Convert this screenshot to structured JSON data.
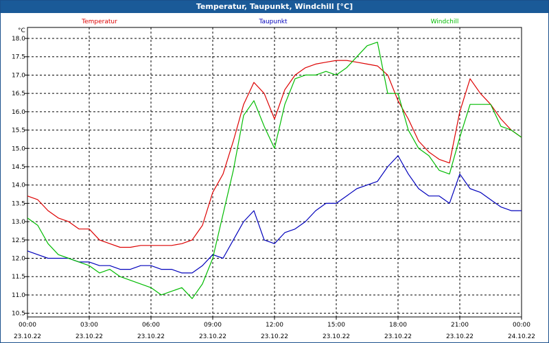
{
  "title": "Temperatur, Taupunkt, Windchill [°C]",
  "unit": "°C",
  "colors": {
    "titlebar": "#1a5a98",
    "temperatur": "#dd0000",
    "taupunkt": "#0000bb",
    "windchill": "#00bb00",
    "grid": "#000000"
  },
  "chart_data": {
    "type": "line",
    "title": "Temperatur, Taupunkt, Windchill [°C]",
    "ylabel": "°C",
    "xlabel": "",
    "ylim": [
      10.4,
      18.3
    ],
    "xlim": [
      0,
      24
    ],
    "grid": true,
    "legend_position": "top",
    "y_ticks": [
      "10.5",
      "11.0",
      "11.5",
      "12.0",
      "12.5",
      "13.0",
      "13.5",
      "14.0",
      "14.5",
      "15.0",
      "15.5",
      "16.0",
      "16.5",
      "17.0",
      "17.5",
      "18.0"
    ],
    "x_ticks": [
      {
        "time": "00:00",
        "date": "23.10.22"
      },
      {
        "time": "03:00",
        "date": "23.10.22"
      },
      {
        "time": "06:00",
        "date": "23.10.22"
      },
      {
        "time": "09:00",
        "date": "23.10.22"
      },
      {
        "time": "12:00",
        "date": "23.10.22"
      },
      {
        "time": "15:00",
        "date": "23.10.22"
      },
      {
        "time": "18:00",
        "date": "23.10.22"
      },
      {
        "time": "21:00",
        "date": "23.10.22"
      },
      {
        "time": "00:00",
        "date": "24.10.22"
      }
    ],
    "series": [
      {
        "name": "Temperatur",
        "color": "#dd0000",
        "x": [
          0,
          0.5,
          1,
          1.5,
          2,
          2.5,
          3,
          3.5,
          4,
          4.5,
          5,
          5.5,
          6,
          6.5,
          7,
          7.5,
          8,
          8.5,
          9,
          9.5,
          10,
          10.5,
          11,
          11.5,
          12,
          12.5,
          13,
          13.5,
          14,
          14.5,
          15,
          15.5,
          16,
          16.5,
          17,
          17.5,
          18,
          18.5,
          19,
          19.5,
          20,
          20.5,
          21,
          21.5,
          22,
          22.5,
          23,
          23.5,
          24
        ],
        "y": [
          13.7,
          13.6,
          13.3,
          13.1,
          13.0,
          12.8,
          12.8,
          12.5,
          12.4,
          12.3,
          12.3,
          12.35,
          12.35,
          12.35,
          12.35,
          12.4,
          12.5,
          12.9,
          13.8,
          14.3,
          15.2,
          16.2,
          16.8,
          16.5,
          15.8,
          16.6,
          17.0,
          17.2,
          17.3,
          17.35,
          17.4,
          17.4,
          17.35,
          17.3,
          17.25,
          17.0,
          16.3,
          15.8,
          15.2,
          14.9,
          14.7,
          14.6,
          16.0,
          16.9,
          16.5,
          16.2,
          15.8,
          15.5,
          15.3
        ]
      },
      {
        "name": "Taupunkt",
        "color": "#0000bb",
        "x": [
          0,
          0.5,
          1,
          1.5,
          2,
          2.5,
          3,
          3.5,
          4,
          4.5,
          5,
          5.5,
          6,
          6.5,
          7,
          7.5,
          8,
          8.5,
          9,
          9.5,
          10,
          10.5,
          11,
          11.5,
          12,
          12.5,
          13,
          13.5,
          14,
          14.5,
          15,
          15.5,
          16,
          16.5,
          17,
          17.5,
          18,
          18.5,
          19,
          19.5,
          20,
          20.5,
          21,
          21.5,
          22,
          22.5,
          23,
          23.5,
          24
        ],
        "y": [
          12.2,
          12.1,
          12.0,
          12.0,
          12.0,
          11.9,
          11.9,
          11.8,
          11.8,
          11.7,
          11.7,
          11.8,
          11.8,
          11.7,
          11.7,
          11.6,
          11.6,
          11.8,
          12.1,
          12.0,
          12.5,
          13.0,
          13.3,
          12.5,
          12.4,
          12.7,
          12.8,
          13.0,
          13.3,
          13.5,
          13.5,
          13.7,
          13.9,
          14.0,
          14.1,
          14.5,
          14.8,
          14.3,
          13.9,
          13.7,
          13.7,
          13.5,
          14.3,
          13.9,
          13.8,
          13.6,
          13.4,
          13.3,
          13.3
        ]
      },
      {
        "name": "Windchill",
        "color": "#00bb00",
        "x": [
          0,
          0.5,
          1,
          1.5,
          2,
          2.5,
          3,
          3.5,
          4,
          4.5,
          5,
          5.5,
          6,
          6.5,
          7,
          7.5,
          8,
          8.5,
          9,
          9.5,
          10,
          10.5,
          11,
          11.5,
          12,
          12.5,
          13,
          13.5,
          14,
          14.5,
          15,
          15.5,
          16,
          16.5,
          17,
          17.5,
          18,
          18.5,
          19,
          19.5,
          20,
          20.5,
          21,
          21.5,
          22,
          22.5,
          23,
          23.5,
          24
        ],
        "y": [
          13.1,
          12.9,
          12.4,
          12.1,
          12.0,
          11.9,
          11.8,
          11.6,
          11.7,
          11.5,
          11.4,
          11.3,
          11.2,
          11.0,
          11.1,
          11.2,
          10.9,
          11.3,
          12.0,
          13.2,
          14.4,
          15.9,
          16.3,
          15.6,
          15.0,
          16.2,
          16.9,
          17.0,
          17.0,
          17.1,
          17.0,
          17.2,
          17.5,
          17.8,
          17.9,
          16.5,
          16.5,
          15.5,
          15.0,
          14.8,
          14.4,
          14.3,
          15.3,
          16.2,
          16.2,
          16.2,
          15.6,
          15.5,
          15.3
        ]
      }
    ]
  }
}
